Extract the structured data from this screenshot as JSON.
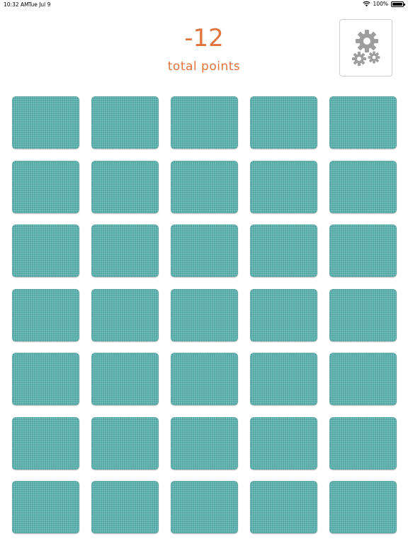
{
  "status_bar": {
    "time": "10:32 AM",
    "date": "Tue Jul 9",
    "battery": "100%",
    "wifi_icon": "wifi-icon",
    "battery_icon": "battery-icon"
  },
  "score": {
    "value": "-12",
    "label": "total points"
  },
  "settings": {
    "icon": "gears-icon"
  },
  "board": {
    "rows": 7,
    "columns": 5,
    "cards_face_down": 35,
    "card_color": "#4fa8a5"
  },
  "colors": {
    "accent": "#e1733c",
    "card": "#4fa8a5",
    "gear": "#9e9e9e"
  }
}
